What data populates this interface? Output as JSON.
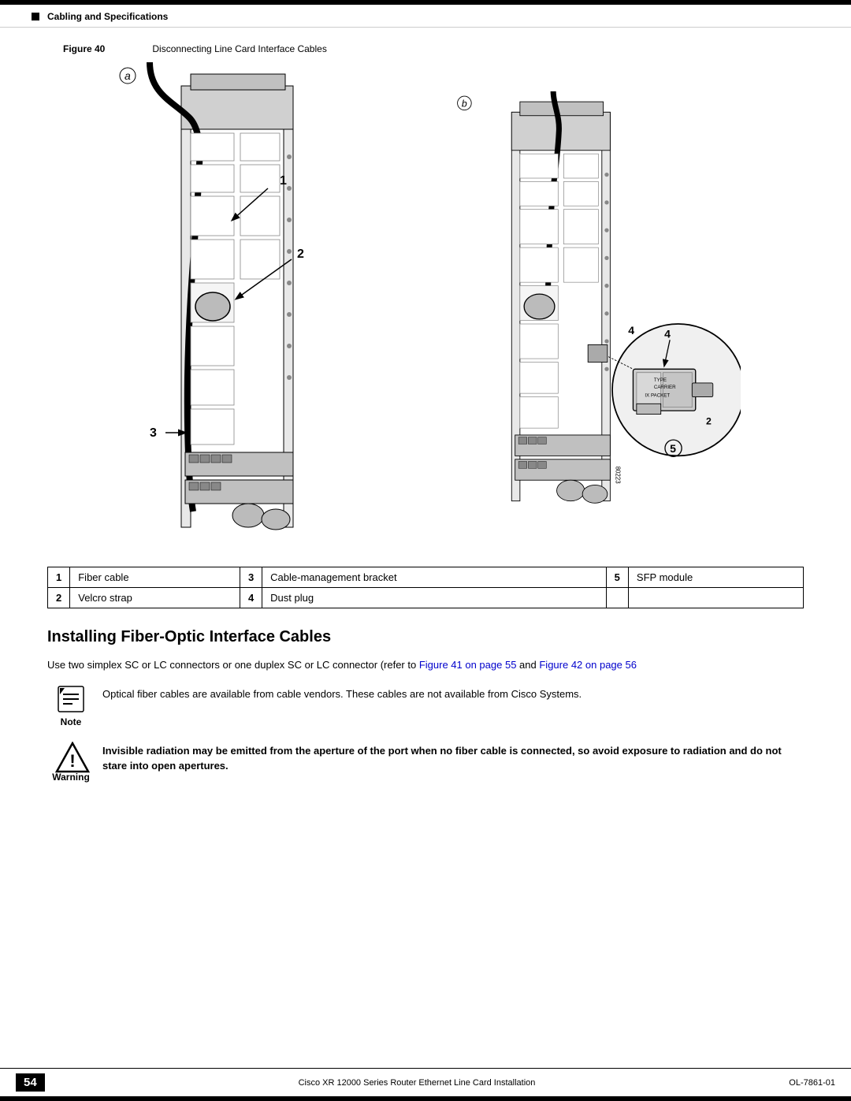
{
  "header": {
    "section": "Cabling and Specifications"
  },
  "figure": {
    "label": "Figure 40",
    "title": "Disconnecting Line Card Interface Cables"
  },
  "legend": {
    "items": [
      {
        "num": "1",
        "label": "Fiber cable"
      },
      {
        "num": "2",
        "label": "Velcro strap"
      },
      {
        "num": "3",
        "label": "Cable-management bracket"
      },
      {
        "num": "4",
        "label": "Dust plug"
      },
      {
        "num": "5",
        "label": "SFP module"
      }
    ]
  },
  "section_heading": "Installing Fiber-Optic Interface Cables",
  "body_text": "Use two simplex SC or LC connectors or one duplex SC or LC connector (refer to Figure 41 on page 55 and Figure 42 on page 56",
  "body_link1": "Figure 41 on page 55",
  "body_link2": "Figure 42 on page 56",
  "note": {
    "label": "Note",
    "text": "Optical fiber cables are available from cable vendors. These cables are not available from Cisco Systems."
  },
  "warning": {
    "label": "Warning",
    "text": "Invisible radiation may be emitted from the aperture of the port when no fiber cable is connected, so avoid exposure to radiation and do not stare into open apertures."
  },
  "footer": {
    "page_number": "54",
    "doc_title": "Cisco XR 12000 Series Router Ethernet Line Card Installation",
    "doc_number": "OL-7861-01"
  }
}
